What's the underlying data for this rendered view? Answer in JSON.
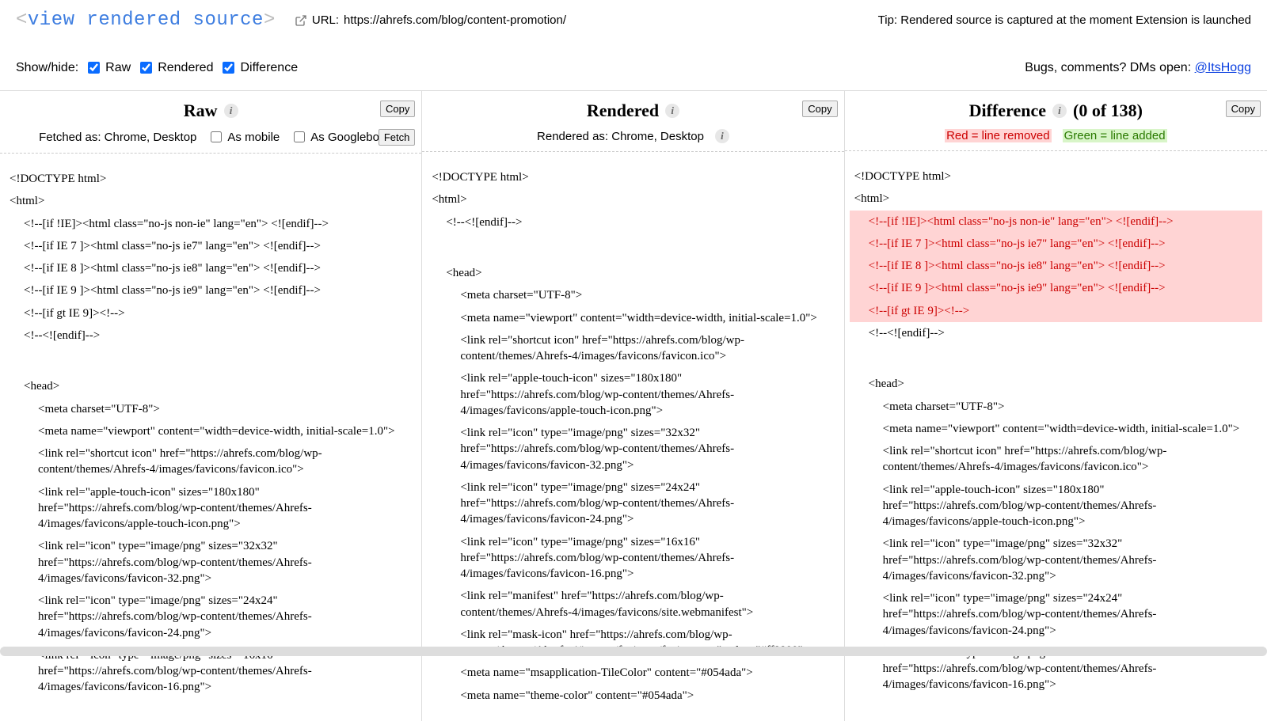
{
  "header": {
    "logo_prefix": "<",
    "logo_text": "view rendered source",
    "logo_suffix": ">",
    "url_label": "URL:",
    "url_value": "https://ahrefs.com/blog/content-promotion/",
    "tip_text": "Tip: Rendered source is captured at the moment Extension is launched"
  },
  "controls": {
    "showhide_label": "Show/hide:",
    "raw_label": "Raw",
    "rendered_label": "Rendered",
    "difference_label": "Difference",
    "raw_checked": true,
    "rendered_checked": true,
    "difference_checked": true,
    "bugs_label": "Bugs, comments? DMs open:",
    "bugs_handle": "@ItsHogg"
  },
  "columns": {
    "raw": {
      "title": "Raw",
      "copy_label": "Copy",
      "fetched_as": "Fetched as: Chrome, Desktop",
      "as_mobile_label": "As mobile",
      "as_googlebot_label": "As Googlebot",
      "fetch_label": "Fetch",
      "code": [
        {
          "indent": 0,
          "text": "<!DOCTYPE html>"
        },
        {
          "indent": 0,
          "text": "<html>"
        },
        {
          "indent": 1,
          "text": "<!--[if !IE]><html class=\"no-js non-ie\" lang=\"en\"> <![endif]-->"
        },
        {
          "indent": 1,
          "text": "<!--[if IE 7 ]><html class=\"no-js ie7\" lang=\"en\"> <![endif]-->"
        },
        {
          "indent": 1,
          "text": "<!--[if IE 8 ]><html class=\"no-js ie8\" lang=\"en\"> <![endif]-->"
        },
        {
          "indent": 1,
          "text": "<!--[if IE 9 ]><html class=\"no-js ie9\" lang=\"en\"> <![endif]-->"
        },
        {
          "indent": 1,
          "text": "<!--[if gt IE 9]><!-->"
        },
        {
          "indent": 1,
          "text": "<!--<![endif]-->"
        },
        {
          "indent": 0,
          "text": " "
        },
        {
          "indent": 1,
          "text": "<head>"
        },
        {
          "indent": 2,
          "text": "<meta charset=\"UTF-8\">"
        },
        {
          "indent": 2,
          "text": "<meta name=\"viewport\" content=\"width=device-width, initial-scale=1.0\">"
        },
        {
          "indent": 2,
          "text": "<link rel=\"shortcut icon\" href=\"https://ahrefs.com/blog/wp-content/themes/Ahrefs-4/images/favicons/favicon.ico\">"
        },
        {
          "indent": 2,
          "text": "<link rel=\"apple-touch-icon\" sizes=\"180x180\" href=\"https://ahrefs.com/blog/wp-content/themes/Ahrefs-4/images/favicons/apple-touch-icon.png\">"
        },
        {
          "indent": 2,
          "text": "<link rel=\"icon\" type=\"image/png\" sizes=\"32x32\" href=\"https://ahrefs.com/blog/wp-content/themes/Ahrefs-4/images/favicons/favicon-32.png\">"
        },
        {
          "indent": 2,
          "text": "<link rel=\"icon\" type=\"image/png\" sizes=\"24x24\" href=\"https://ahrefs.com/blog/wp-content/themes/Ahrefs-4/images/favicons/favicon-24.png\">"
        },
        {
          "indent": 2,
          "text": "<link rel=\"icon\" type=\"image/png\" sizes=\"16x16\" href=\"https://ahrefs.com/blog/wp-content/themes/Ahrefs-4/images/favicons/favicon-16.png\">"
        }
      ]
    },
    "rendered": {
      "title": "Rendered",
      "copy_label": "Copy",
      "rendered_as": "Rendered as: Chrome, Desktop",
      "code": [
        {
          "indent": 0,
          "text": "<!DOCTYPE html>"
        },
        {
          "indent": 0,
          "text": "<html>"
        },
        {
          "indent": 1,
          "text": "<!--<![endif]-->"
        },
        {
          "indent": 0,
          "text": " "
        },
        {
          "indent": 1,
          "text": "<head>"
        },
        {
          "indent": 2,
          "text": "<meta charset=\"UTF-8\">"
        },
        {
          "indent": 2,
          "text": "<meta name=\"viewport\" content=\"width=device-width, initial-scale=1.0\">"
        },
        {
          "indent": 2,
          "text": "<link rel=\"shortcut icon\" href=\"https://ahrefs.com/blog/wp-content/themes/Ahrefs-4/images/favicons/favicon.ico\">"
        },
        {
          "indent": 2,
          "text": "<link rel=\"apple-touch-icon\" sizes=\"180x180\" href=\"https://ahrefs.com/blog/wp-content/themes/Ahrefs-4/images/favicons/apple-touch-icon.png\">"
        },
        {
          "indent": 2,
          "text": "<link rel=\"icon\" type=\"image/png\" sizes=\"32x32\" href=\"https://ahrefs.com/blog/wp-content/themes/Ahrefs-4/images/favicons/favicon-32.png\">"
        },
        {
          "indent": 2,
          "text": "<link rel=\"icon\" type=\"image/png\" sizes=\"24x24\" href=\"https://ahrefs.com/blog/wp-content/themes/Ahrefs-4/images/favicons/favicon-24.png\">"
        },
        {
          "indent": 2,
          "text": "<link rel=\"icon\" type=\"image/png\" sizes=\"16x16\" href=\"https://ahrefs.com/blog/wp-content/themes/Ahrefs-4/images/favicons/favicon-16.png\">"
        },
        {
          "indent": 2,
          "text": "<link rel=\"manifest\" href=\"https://ahrefs.com/blog/wp-content/themes/Ahrefs-4/images/favicons/site.webmanifest\">"
        },
        {
          "indent": 2,
          "text": "<link rel=\"mask-icon\" href=\"https://ahrefs.com/blog/wp-content/themes/Ahrefs-4/images/favicons/favicon.svg\" color=\"#ff8800\">"
        },
        {
          "indent": 2,
          "text": "<meta name=\"msapplication-TileColor\" content=\"#054ada\">"
        },
        {
          "indent": 2,
          "text": "<meta name=\"theme-color\" content=\"#054ada\">"
        }
      ]
    },
    "difference": {
      "title": "Difference",
      "count_prefix": "(",
      "count_current": 0,
      "count_of": "of",
      "count_total": 138,
      "count_suffix": ")",
      "copy_label": "Copy",
      "legend_removed": "Red = line removed",
      "legend_added": "Green = line added",
      "code": [
        {
          "indent": 0,
          "status": "",
          "text": "<!DOCTYPE html>"
        },
        {
          "indent": 0,
          "status": "",
          "text": "<html>"
        },
        {
          "indent": 1,
          "status": "removed",
          "text": "<!--[if !IE]><html class=\"no-js non-ie\" lang=\"en\"> <![endif]-->"
        },
        {
          "indent": 1,
          "status": "removed",
          "text": "<!--[if IE 7 ]><html class=\"no-js ie7\" lang=\"en\"> <![endif]-->"
        },
        {
          "indent": 1,
          "status": "removed",
          "text": "<!--[if IE 8 ]><html class=\"no-js ie8\" lang=\"en\"> <![endif]-->"
        },
        {
          "indent": 1,
          "status": "removed",
          "text": "<!--[if IE 9 ]><html class=\"no-js ie9\" lang=\"en\"> <![endif]-->"
        },
        {
          "indent": 1,
          "status": "removed",
          "text": "<!--[if gt IE 9]><!-->"
        },
        {
          "indent": 1,
          "status": "",
          "text": "<!--<![endif]-->"
        },
        {
          "indent": 0,
          "status": "",
          "text": " "
        },
        {
          "indent": 1,
          "status": "",
          "text": "<head>"
        },
        {
          "indent": 2,
          "status": "",
          "text": "<meta charset=\"UTF-8\">"
        },
        {
          "indent": 2,
          "status": "",
          "text": "<meta name=\"viewport\" content=\"width=device-width, initial-scale=1.0\">"
        },
        {
          "indent": 2,
          "status": "",
          "text": "<link rel=\"shortcut icon\" href=\"https://ahrefs.com/blog/wp-content/themes/Ahrefs-4/images/favicons/favicon.ico\">"
        },
        {
          "indent": 2,
          "status": "",
          "text": "<link rel=\"apple-touch-icon\" sizes=\"180x180\" href=\"https://ahrefs.com/blog/wp-content/themes/Ahrefs-4/images/favicons/apple-touch-icon.png\">"
        },
        {
          "indent": 2,
          "status": "",
          "text": "<link rel=\"icon\" type=\"image/png\" sizes=\"32x32\" href=\"https://ahrefs.com/blog/wp-content/themes/Ahrefs-4/images/favicons/favicon-32.png\">"
        },
        {
          "indent": 2,
          "status": "",
          "text": "<link rel=\"icon\" type=\"image/png\" sizes=\"24x24\" href=\"https://ahrefs.com/blog/wp-content/themes/Ahrefs-4/images/favicons/favicon-24.png\">"
        },
        {
          "indent": 2,
          "status": "",
          "text": "<link rel=\"icon\" type=\"image/png\" sizes=\"16x16\" href=\"https://ahrefs.com/blog/wp-content/themes/Ahrefs-4/images/favicons/favicon-16.png\">"
        }
      ]
    }
  }
}
